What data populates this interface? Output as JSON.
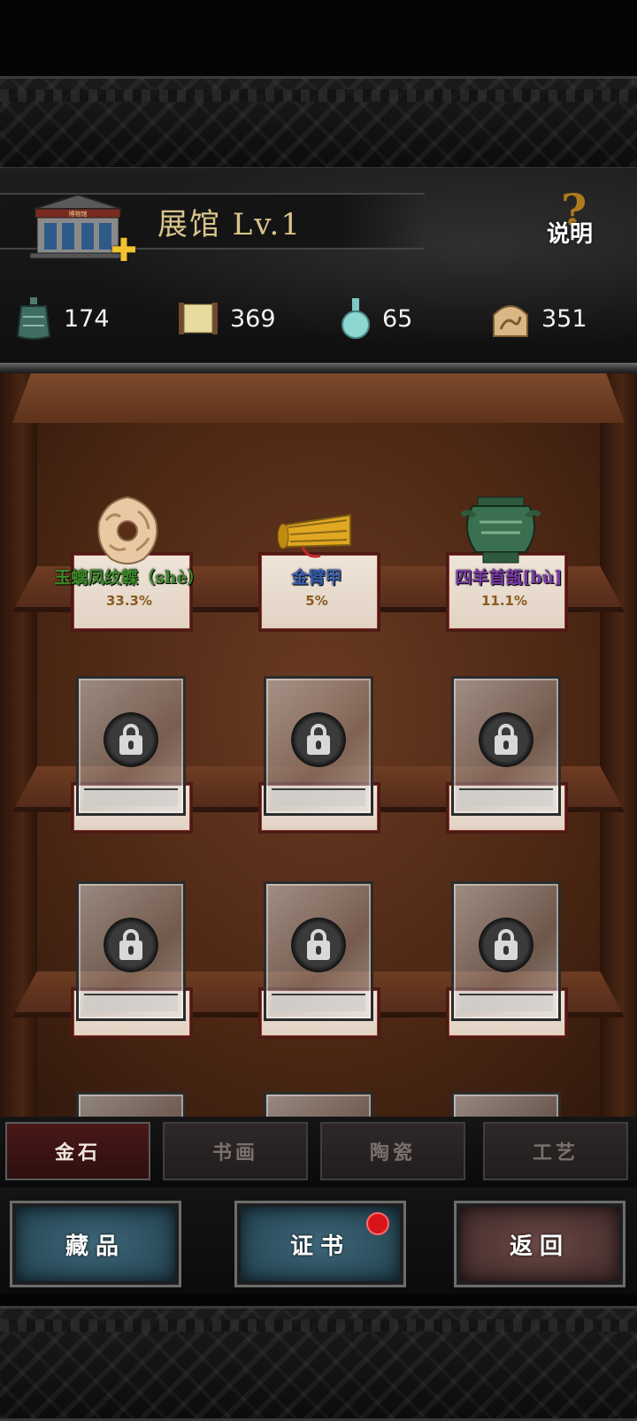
{
  "header": {
    "hall_title": "展馆  Lv.1",
    "museum_sign": "博物馆",
    "help_label": "说明",
    "resources": [
      {
        "icon": "bronze-bell-icon",
        "value": "174"
      },
      {
        "icon": "scroll-icon",
        "value": "369"
      },
      {
        "icon": "vase-icon",
        "value": "65"
      },
      {
        "icon": "jade-relic-icon",
        "value": "351"
      }
    ]
  },
  "display": {
    "items": [
      {
        "name": "玉螭凤纹韘（shè）",
        "rate": "33.3%",
        "name_color": "#3f8a2a",
        "icon": "jade-pendant-icon"
      },
      {
        "name": "金臂甲",
        "rate": "5%",
        "name_color": "#3a5fb0",
        "icon": "gold-armguard-icon"
      },
      {
        "name": "四羊首瓿[bù]",
        "rate": "11.1%",
        "name_color": "#7a3aa8",
        "icon": "bronze-vessel-icon"
      }
    ]
  },
  "tabs": [
    {
      "label": "金石",
      "active": true
    },
    {
      "label": "书画",
      "active": false
    },
    {
      "label": "陶瓷",
      "active": false
    },
    {
      "label": "工艺",
      "active": false
    }
  ],
  "actions": {
    "collection": "藏品",
    "certificate": "证书",
    "back": "返回"
  }
}
